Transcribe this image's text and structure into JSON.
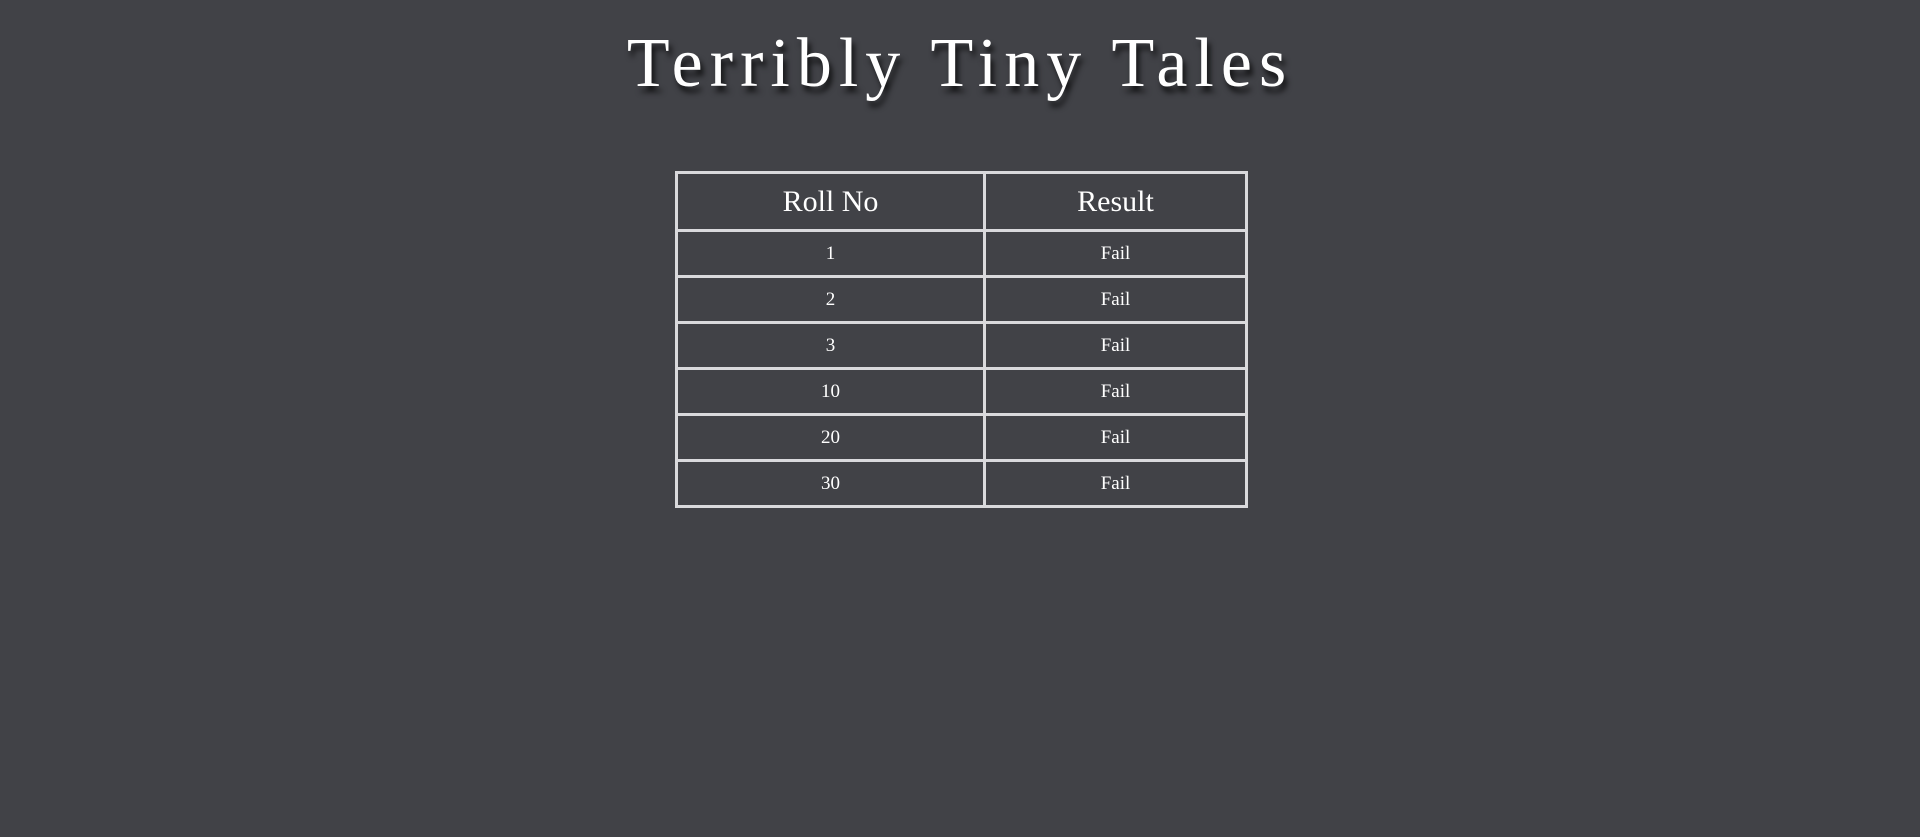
{
  "header": {
    "title": "Terribly Tiny Tales"
  },
  "table": {
    "headers": [
      "Roll No",
      "Result"
    ],
    "rows": [
      {
        "roll": "1",
        "result": "Fail"
      },
      {
        "roll": "2",
        "result": "Fail"
      },
      {
        "roll": "3",
        "result": "Fail"
      },
      {
        "roll": "10",
        "result": "Fail"
      },
      {
        "roll": "20",
        "result": "Fail"
      },
      {
        "roll": "30",
        "result": "Fail"
      }
    ]
  },
  "colors": {
    "background": "#414247",
    "text": "#ffffff",
    "border": "#d9d9dc"
  }
}
